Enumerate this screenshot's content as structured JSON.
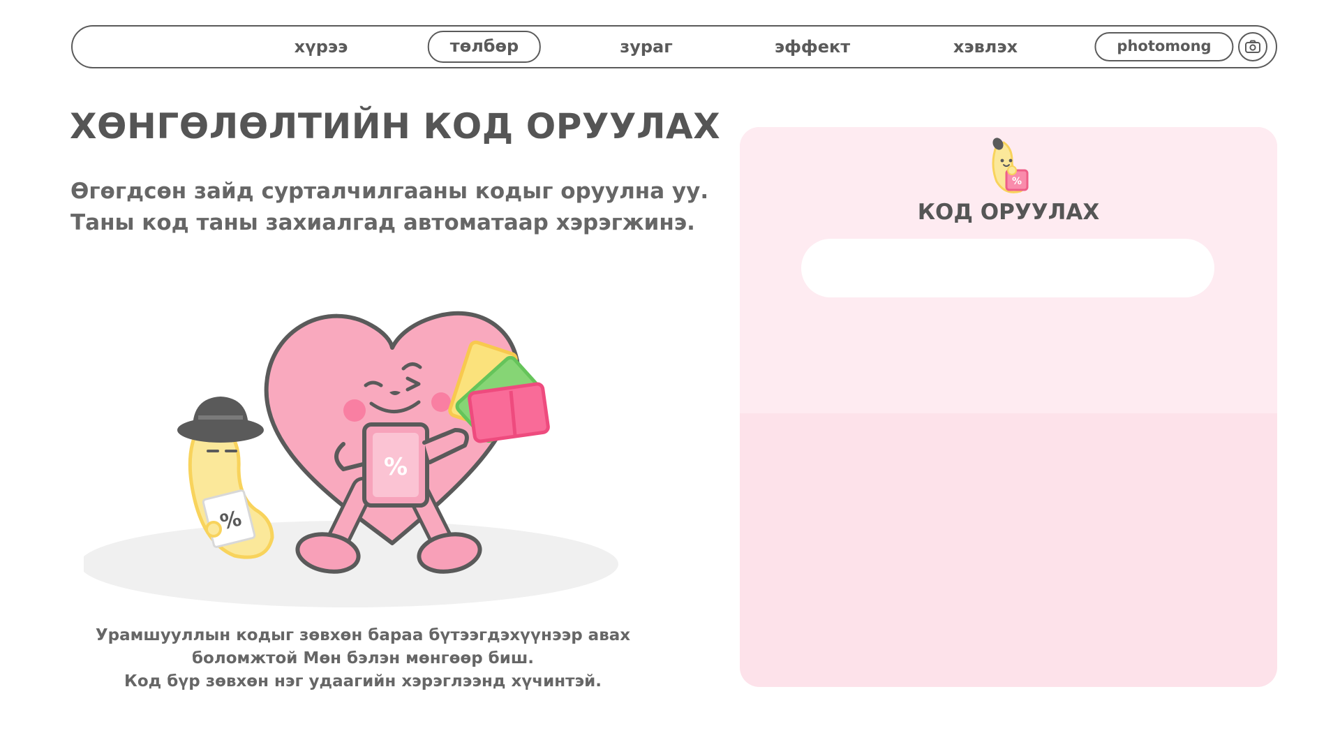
{
  "nav": {
    "items": [
      {
        "label": "хүрээ",
        "active": false
      },
      {
        "label": "төлбөр",
        "active": true
      },
      {
        "label": "зураг",
        "active": false
      },
      {
        "label": "эффект",
        "active": false
      },
      {
        "label": "хэвлэх",
        "active": false
      }
    ],
    "brand_label": "photomong",
    "camera_icon": "camera-icon"
  },
  "main": {
    "title": "ХӨНГӨЛӨЛТИЙН КОД ОРУУЛАХ",
    "description_lines": [
      "Өгөгдсөн зайд сурталчилгааны кодыг оруулна уу.",
      "Таны код таны захиалгад автоматаар хэрэгжинэ."
    ],
    "notice_lines": [
      "Урамшууллын кодыг зөвхөн бараа бүтээгдэхүүнээр авах",
      "боломжтой Мөн бэлэн мөнгөөр биш.",
      "Код бүр зөвхөн нэг удаагийн хэрэглээнд хүчинтэй."
    ]
  },
  "panel": {
    "title": "КОД ОРУУЛАХ",
    "input_value": "",
    "input_placeholder": ""
  },
  "colors": {
    "text": "#5a5a5a",
    "panel_top": "#feebf1",
    "panel_bottom": "#fde2ea",
    "heart_pink": "#f7a3bb",
    "banana_yellow": "#fbe89a"
  }
}
